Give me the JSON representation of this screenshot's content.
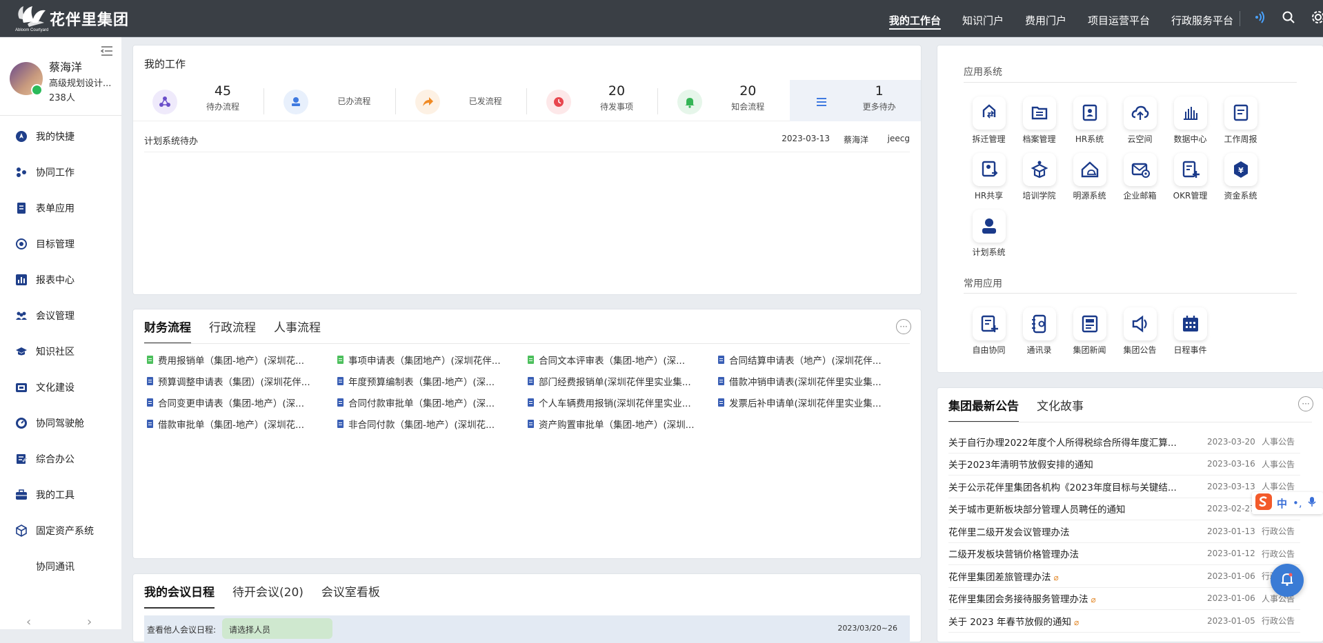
{
  "header": {
    "logo_text": "花伴里集团",
    "logo_sub": "Abloom Courtyard",
    "nav": [
      "我的工作台",
      "知识门户",
      "费用门户",
      "项目运营平台",
      "行政服务平台"
    ],
    "active_nav": 0,
    "icons": [
      "broadcast-icon",
      "search-icon",
      "settings-icon"
    ]
  },
  "user": {
    "name": "蔡海洋",
    "title": "高级规划设计...",
    "count": "238人"
  },
  "sidebar": {
    "items": [
      {
        "label": "我的快捷",
        "icon": "compass-icon"
      },
      {
        "label": "协同工作",
        "icon": "collab-icon"
      },
      {
        "label": "表单应用",
        "icon": "form-icon"
      },
      {
        "label": "目标管理",
        "icon": "target-icon"
      },
      {
        "label": "报表中心",
        "icon": "report-icon"
      },
      {
        "label": "会议管理",
        "icon": "meeting-icon"
      },
      {
        "label": "知识社区",
        "icon": "knowledge-icon"
      },
      {
        "label": "文化建设",
        "icon": "culture-icon"
      },
      {
        "label": "协同驾驶舱",
        "icon": "dashboard-icon"
      },
      {
        "label": "综合办公",
        "icon": "office-icon"
      },
      {
        "label": "我的工具",
        "icon": "toolbox-icon"
      },
      {
        "label": "固定资产系统",
        "icon": "asset-icon"
      },
      {
        "label": "协同通讯",
        "icon": ""
      }
    ],
    "arrow_prev": "‹",
    "arrow_next": "›"
  },
  "my_work": {
    "title": "我的工作",
    "stats": [
      {
        "num": "45",
        "label": "待办流程",
        "color": "#6b4fc9",
        "bg": "#efeafb"
      },
      {
        "num": "",
        "label": "已办流程",
        "color": "#3f7ae0",
        "bg": "#e8f0fc"
      },
      {
        "num": "",
        "label": "已发流程",
        "color": "#f08a24",
        "bg": "#fdf1e4"
      },
      {
        "num": "20",
        "label": "待发事项",
        "color": "#e8474f",
        "bg": "#fde8e9"
      },
      {
        "num": "20",
        "label": "知会流程",
        "color": "#35b556",
        "bg": "#e6f6ea"
      },
      {
        "num": "1",
        "label": "更多待办",
        "color": "#3f7ae0",
        "bg": "#eef2f8"
      }
    ],
    "todo": {
      "title": "计划系统待办",
      "date": "2023-03-13",
      "user": "蔡海洋",
      "source": "jeecg"
    }
  },
  "flows": {
    "tabs": [
      "财务流程",
      "行政流程",
      "人事流程"
    ],
    "active": 0,
    "more": "···",
    "items": [
      {
        "t": "费用报销单（集团-地产）(深圳花...",
        "c": "#4cbf5c"
      },
      {
        "t": "事项申请表（集团地产）(深圳花伴...",
        "c": "#4cbf5c"
      },
      {
        "t": "合同文本评审表（集团-地产）(深...",
        "c": "#4cbf5c"
      },
      {
        "t": "合同结算申请表（地产）(深圳花伴...",
        "c": "#3a5fb5"
      },
      {
        "t": "预算调整申请表（集团）(深圳花伴...",
        "c": "#3a5fb5"
      },
      {
        "t": "年度预算编制表（集团-地产）(深...",
        "c": "#3a5fb5"
      },
      {
        "t": "部门经费报销单(深圳花伴里实业集...",
        "c": "#3a5fb5"
      },
      {
        "t": "借款冲销申请表(深圳花伴里实业集...",
        "c": "#3a5fb5"
      },
      {
        "t": "合同变更申请表（集团-地产）(深...",
        "c": "#3a5fb5"
      },
      {
        "t": "合同付款审批单（集团-地产）(深...",
        "c": "#3a5fb5"
      },
      {
        "t": "个人车辆费用报销(深圳花伴里实业...",
        "c": "#3a5fb5"
      },
      {
        "t": "发票后补申请单(深圳花伴里实业集...",
        "c": "#3a5fb5"
      },
      {
        "t": "借款审批单（集团-地产）(深圳花...",
        "c": "#3a5fb5"
      },
      {
        "t": "非合同付款（集团-地产）(深圳花...",
        "c": "#3a5fb5"
      },
      {
        "t": "资产购置审批单（集团-地产）(深圳...",
        "c": "#3a5fb5"
      }
    ]
  },
  "meetings": {
    "tabs": [
      "我的会议日程",
      "待开会议(20)",
      "会议室看板"
    ],
    "active": 0,
    "filter_label": "查看他人会议日程:",
    "filter_placeholder": "请选择人员",
    "week": "2023/03/20~26"
  },
  "apps": {
    "section1": "应用系统",
    "section2": "常用应用",
    "systems": [
      {
        "label": "拆迁管理",
        "icon": "relocation-icon"
      },
      {
        "label": "档案管理",
        "icon": "archive-icon"
      },
      {
        "label": "HR系统",
        "icon": "hr-icon"
      },
      {
        "label": "云空间",
        "icon": "cloud-icon"
      },
      {
        "label": "数据中心",
        "icon": "data-icon"
      },
      {
        "label": "工作周报",
        "icon": "weekly-icon"
      },
      {
        "label": "HR共享",
        "icon": "hr-share-icon"
      },
      {
        "label": "培训学院",
        "icon": "training-icon"
      },
      {
        "label": "明源系统",
        "icon": "mingyuan-icon"
      },
      {
        "label": "企业邮箱",
        "icon": "mail-icon"
      },
      {
        "label": "OKR管理",
        "icon": "okr-icon"
      },
      {
        "label": "资金系统",
        "icon": "fund-icon"
      },
      {
        "label": "计划系统",
        "icon": "plan-icon"
      }
    ],
    "common": [
      {
        "label": "自由协同",
        "icon": "free-collab-icon"
      },
      {
        "label": "通讯录",
        "icon": "contacts-icon"
      },
      {
        "label": "集团新闻",
        "icon": "news-icon"
      },
      {
        "label": "集团公告",
        "icon": "announce-icon"
      },
      {
        "label": "日程事件",
        "icon": "calendar-icon"
      }
    ]
  },
  "notices": {
    "tabs": [
      "集团最新公告",
      "文化故事"
    ],
    "active": 0,
    "more": "···",
    "items": [
      {
        "t": "关于自行办理2022年度个人所得税综合所得年度汇算...",
        "d": "2023-03-20",
        "c": "人事公告",
        "clip": false
      },
      {
        "t": "关于2023年清明节放假安排的通知",
        "d": "2023-03-16",
        "c": "人事公告",
        "clip": false
      },
      {
        "t": "关于公示花伴里集团各机构《2023年度目标与关键结...",
        "d": "2023-03-13",
        "c": "人事公告",
        "clip": false
      },
      {
        "t": "关于城市更新板块部分管理人员聘任的通知",
        "d": "2023-02-27",
        "c": "人事公告",
        "clip": false
      },
      {
        "t": "花伴里二级开发会议管理办法",
        "d": "2023-01-13",
        "c": "行政公告",
        "clip": false
      },
      {
        "t": "二级开发板块营销价格管理办法",
        "d": "2023-01-12",
        "c": "行政公告",
        "clip": false
      },
      {
        "t": "花伴里集团差旅管理办法",
        "d": "2023-01-06",
        "c": "行政公告",
        "clip": true
      },
      {
        "t": "花伴里集团会务接待服务管理办法",
        "d": "2023-01-06",
        "c": "人事公告",
        "clip": true
      },
      {
        "t": "关于 2023 年春节放假的通知",
        "d": "2023-01-05",
        "c": "行政公告",
        "clip": true
      }
    ]
  },
  "ime": {
    "text": "中"
  }
}
